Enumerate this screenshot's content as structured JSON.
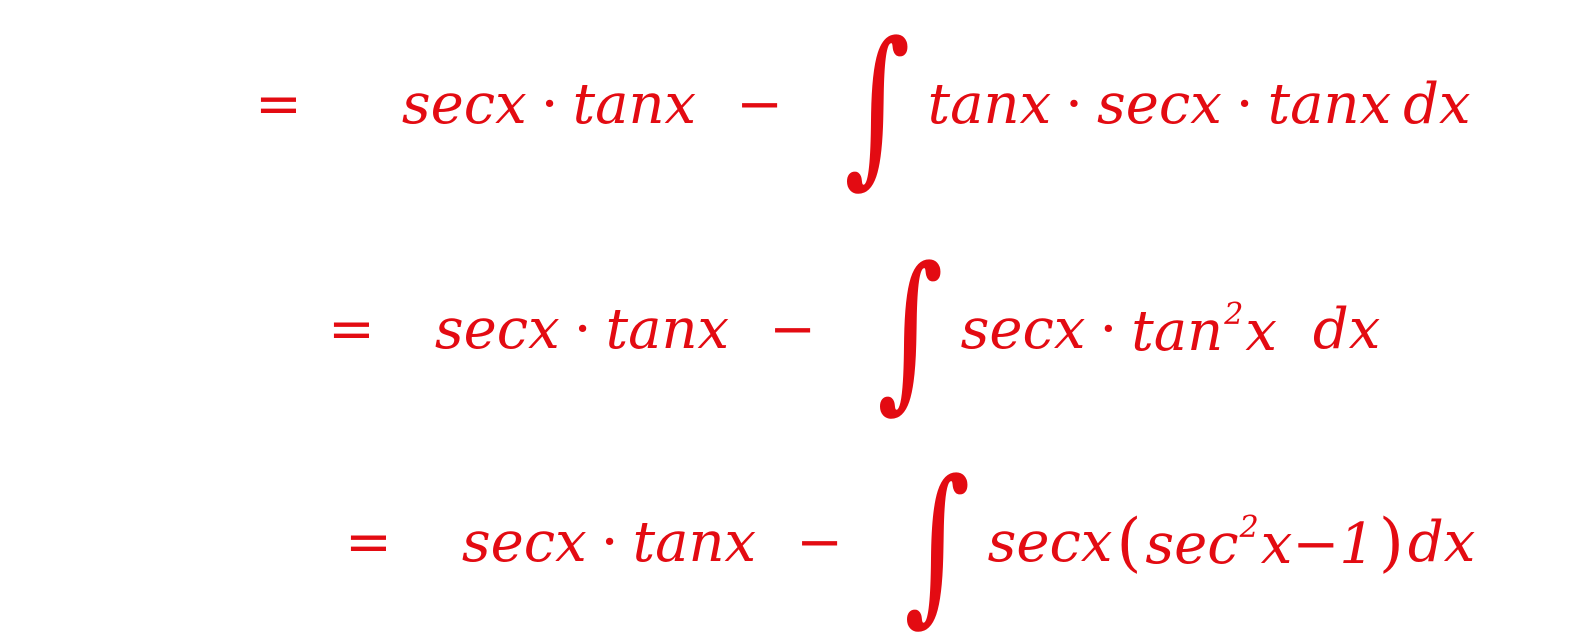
{
  "ink_color": "#e30b12",
  "line1": {
    "eq": "=",
    "term1": "secx",
    "dot1": "·",
    "term2": "tanx",
    "minus": "−",
    "integral": "∫",
    "int_a": "tanx",
    "dot2": "·",
    "int_b": "secx",
    "dot3": "·",
    "int_c": "tanx",
    "dx": "dx"
  },
  "line2": {
    "eq": "=",
    "term1": "secx",
    "dot1": "·",
    "term2": "tanx",
    "minus": "−",
    "integral": "∫",
    "int_a": "secx",
    "dot2": "·",
    "int_b_base": "tan",
    "int_b_power": "2",
    "int_b_var": "x",
    "dx": "dx"
  },
  "line3": {
    "eq": "=",
    "term1": "secx",
    "dot1": "·",
    "term2": "tanx",
    "minus": "−",
    "integral": "∫",
    "int_a": "secx",
    "lparen": "(",
    "int_b_base": "sec",
    "int_b_power": "2",
    "int_b_var": "x",
    "int_b_minus": "−1",
    "rparen": ")",
    "dx": "dx"
  }
}
